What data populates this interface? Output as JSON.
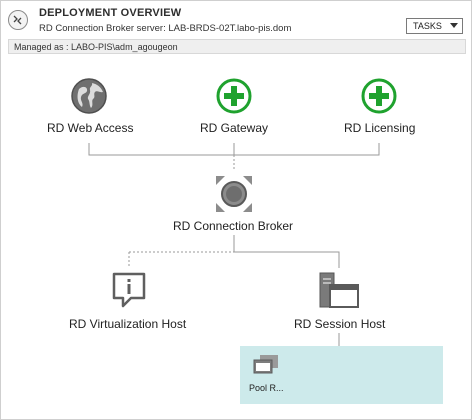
{
  "header": {
    "title": "DEPLOYMENT OVERVIEW",
    "subtitle": "RD Connection Broker server: LAB-BRDS-02T.labo-pis.dom",
    "tasks_label": "TASKS"
  },
  "managed_as": "Managed as : LABO-PIS\\adm_agougeon",
  "nodes": {
    "web_access": {
      "label": "RD Web Access",
      "icon": "globe-icon"
    },
    "gateway": {
      "label": "RD Gateway",
      "icon": "plus-circle-icon"
    },
    "licensing": {
      "label": "RD Licensing",
      "icon": "plus-circle-icon"
    },
    "broker": {
      "label": "RD Connection Broker",
      "icon": "connection-broker-icon"
    },
    "virtualization": {
      "label": "RD Virtualization Host",
      "icon": "info-callout-icon"
    },
    "session": {
      "label": "RD Session Host",
      "icon": "server-window-icon"
    }
  },
  "collection": {
    "label": "Pool R..."
  },
  "colors": {
    "accent_green": "#1fa22e",
    "pool_bg": "#cdeaeb",
    "line": "#9a9a9a"
  }
}
